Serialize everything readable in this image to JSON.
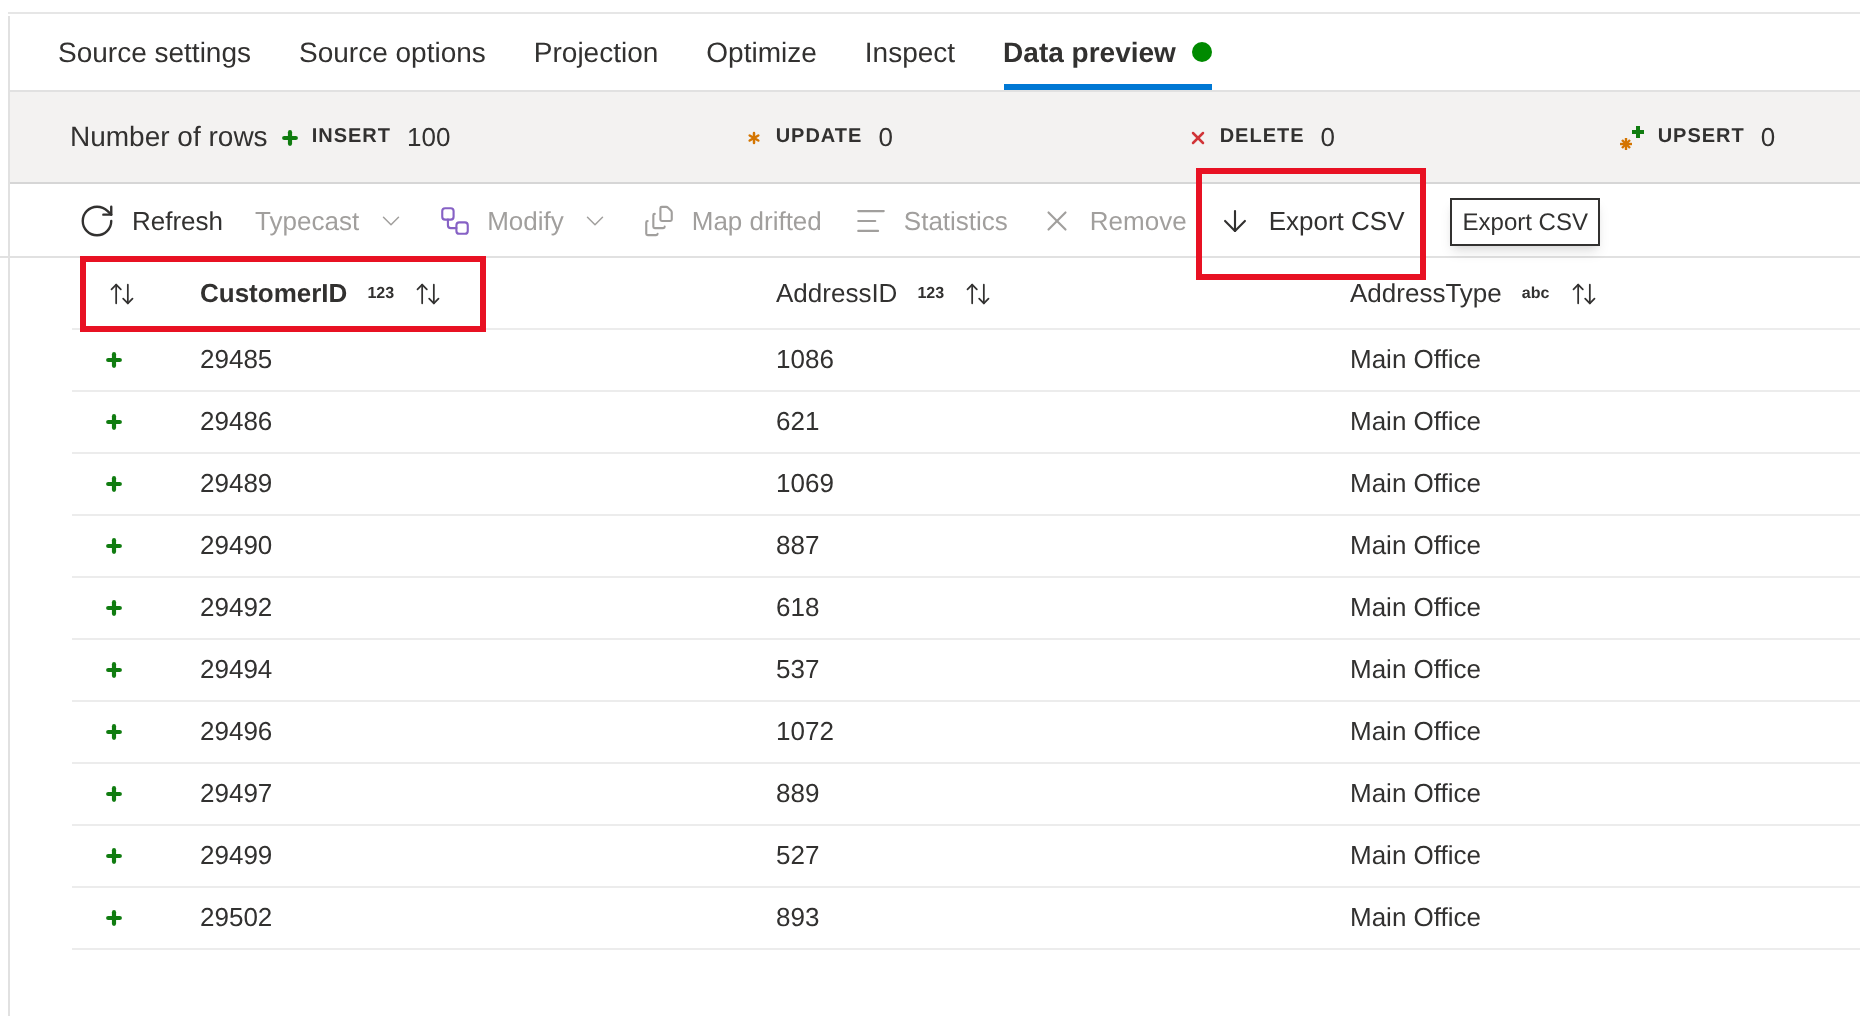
{
  "tabs": [
    {
      "label": "Source settings",
      "selected": false
    },
    {
      "label": "Source options",
      "selected": false
    },
    {
      "label": "Projection",
      "selected": false
    },
    {
      "label": "Optimize",
      "selected": false
    },
    {
      "label": "Inspect",
      "selected": false
    },
    {
      "label": "Data preview",
      "selected": true,
      "color": "#008a00"
    }
  ],
  "row_counts": {
    "label": "Number of rows",
    "items": [
      {
        "kind": "insert",
        "label": "INSERT",
        "value": "100"
      },
      {
        "kind": "update",
        "label": "UPDATE",
        "value": "0"
      },
      {
        "kind": "delete",
        "label": "DELETE",
        "value": "0"
      },
      {
        "kind": "upsert",
        "label": "UPSERT",
        "value": "0"
      }
    ]
  },
  "toolbar": [
    {
      "kind": "refresh",
      "label": "Refresh",
      "disabled": false,
      "highlighted": false
    },
    {
      "kind": "typecast",
      "label": "Typecast",
      "disabled": true,
      "highlighted": false
    },
    {
      "kind": "modify",
      "label": "Modify",
      "disabled": true,
      "highlighted": false
    },
    {
      "kind": "map",
      "label": "Map drifted",
      "disabled": true,
      "highlighted": false
    },
    {
      "kind": "statistics",
      "label": "Statistics",
      "disabled": true,
      "highlighted": false
    },
    {
      "kind": "remove",
      "label": "Remove",
      "disabled": true,
      "highlighted": false
    },
    {
      "kind": "export",
      "label": "Export CSV",
      "disabled": false,
      "highlighted": true
    }
  ],
  "tooltip": "Export CSV",
  "table": {
    "columns": [
      {
        "label": "CustomerID",
        "type": "123",
        "highlighted": true
      },
      {
        "label": "AddressID",
        "type": "123",
        "highlighted": false
      },
      {
        "label": "AddressType",
        "type": "abc",
        "highlighted": false
      }
    ],
    "rows": [
      {
        "kind": "insert",
        "cells": [
          "29485",
          "1086",
          "Main Office"
        ]
      },
      {
        "kind": "insert",
        "cells": [
          "29486",
          "621",
          "Main Office"
        ]
      },
      {
        "kind": "insert",
        "cells": [
          "29489",
          "1069",
          "Main Office"
        ]
      },
      {
        "kind": "insert",
        "cells": [
          "29490",
          "887",
          "Main Office"
        ]
      },
      {
        "kind": "insert",
        "cells": [
          "29492",
          "618",
          "Main Office"
        ]
      },
      {
        "kind": "insert",
        "cells": [
          "29494",
          "537",
          "Main Office"
        ]
      },
      {
        "kind": "insert",
        "cells": [
          "29496",
          "1072",
          "Main Office"
        ]
      },
      {
        "kind": "insert",
        "cells": [
          "29497",
          "889",
          "Main Office"
        ]
      },
      {
        "kind": "insert",
        "cells": [
          "29499",
          "527",
          "Main Office"
        ]
      },
      {
        "kind": "insert",
        "cells": [
          "29502",
          "893",
          "Main Office"
        ]
      }
    ]
  }
}
